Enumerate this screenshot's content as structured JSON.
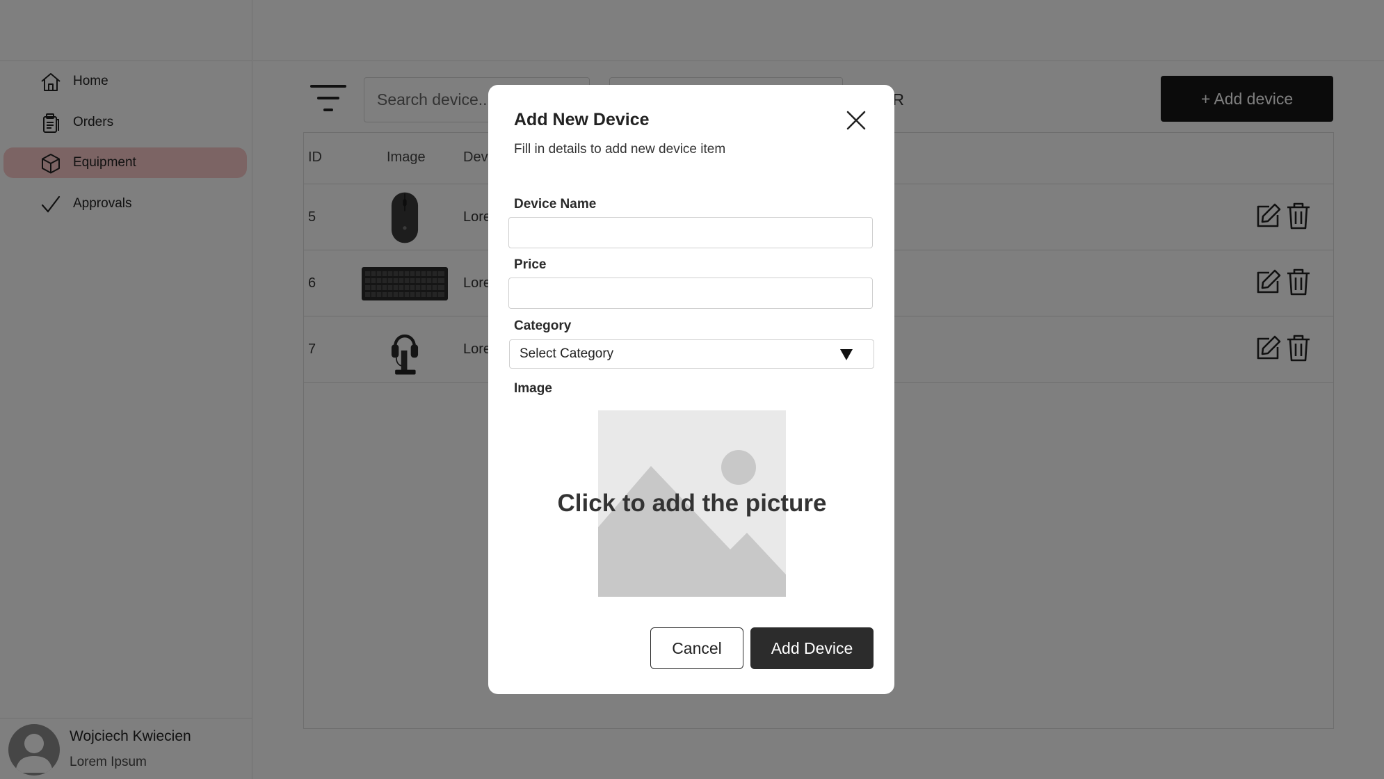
{
  "sidebar": {
    "items": [
      {
        "label": "Home",
        "icon": "home-icon"
      },
      {
        "label": "Orders",
        "icon": "clipboard-icon"
      },
      {
        "label": "Equipment",
        "icon": "box-icon",
        "active": true
      },
      {
        "label": "Approvals",
        "icon": "checkmark-icon"
      }
    ],
    "user": {
      "name": "Wojciech Kwiecien",
      "role": "Lorem Ipsum"
    }
  },
  "toolbar": {
    "search_placeholder": "Search device...",
    "partial_text": "AR",
    "add_button_label": "+ Add device"
  },
  "table": {
    "headers": [
      "ID",
      "Image",
      "Devi"
    ],
    "rows": [
      {
        "id": "5",
        "image": "mouse",
        "name": "Lore"
      },
      {
        "id": "6",
        "image": "keyboard",
        "name": "Lore"
      },
      {
        "id": "7",
        "image": "headset",
        "name": "Lore"
      }
    ]
  },
  "modal": {
    "title": "Add New Device",
    "subtitle": "Fill in details to add new device item",
    "device_name_label": "Device Name",
    "device_name_value": "",
    "price_label": "Price",
    "price_value": "",
    "category_label": "Category",
    "category_selected": "Select Category",
    "image_label": "Image",
    "image_prompt": "Click to add the picture",
    "cancel_label": "Cancel",
    "submit_label": "Add Device"
  },
  "colors": {
    "accent_active": "#f8c9c9",
    "primary_button": "#2c2c2c",
    "overlay": "rgba(0,0,0,0.5)"
  }
}
